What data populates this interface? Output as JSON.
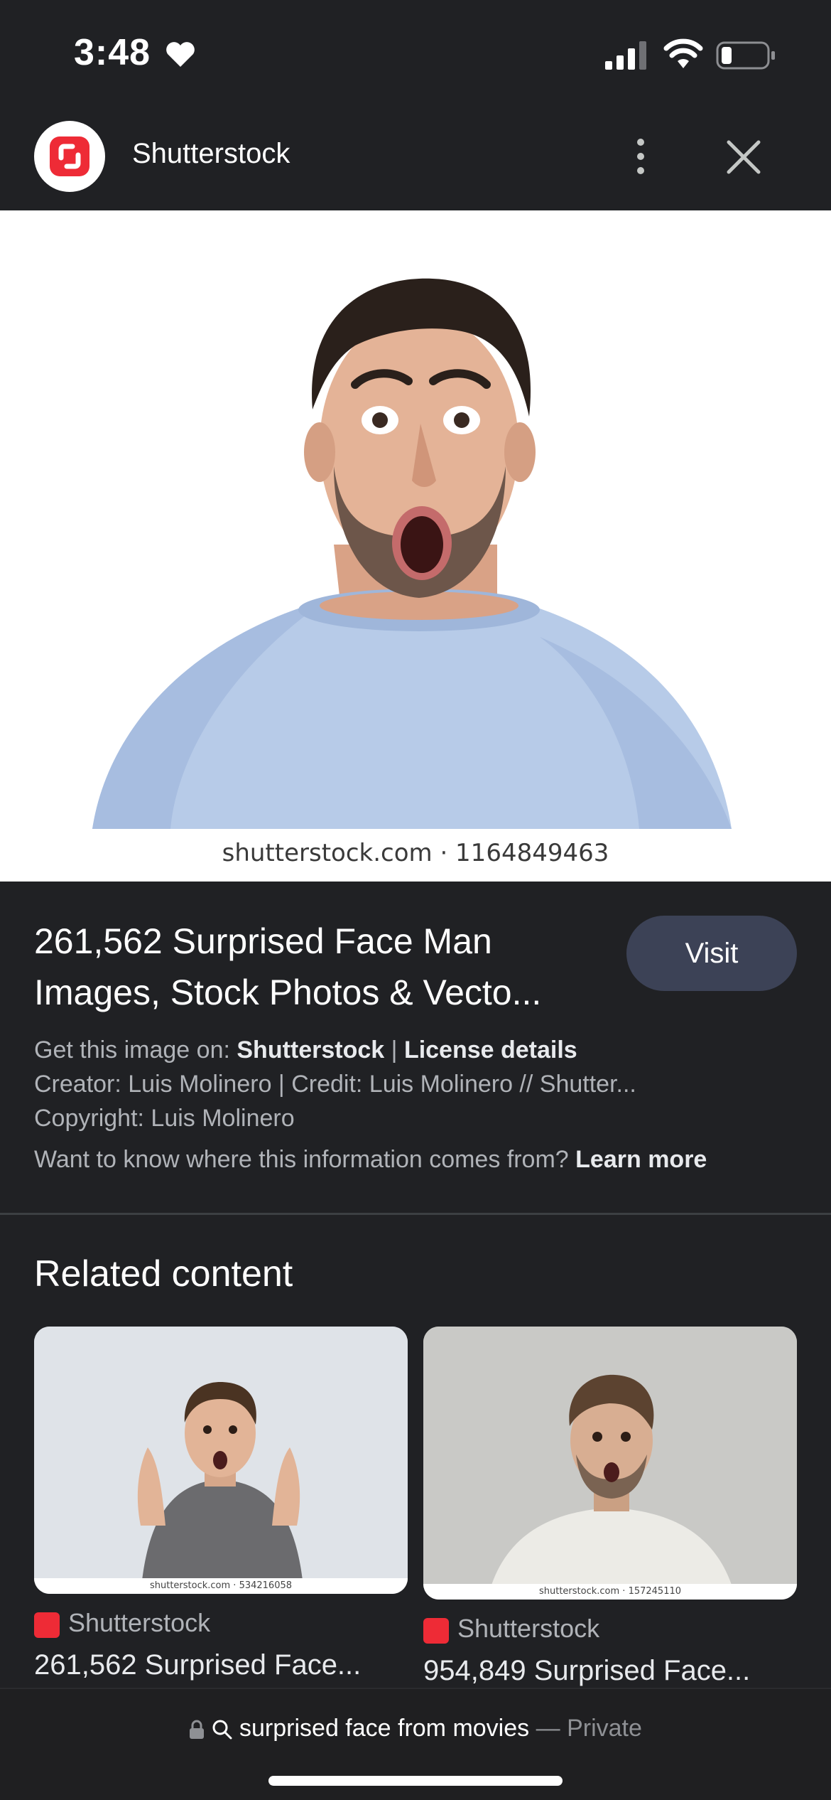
{
  "status": {
    "time": "3:48",
    "icons": [
      "heart-icon",
      "cellular-signal-icon",
      "wifi-icon",
      "battery-icon"
    ]
  },
  "header": {
    "source_name": "Shutterstock",
    "logo_icon": "shutterstock-logo",
    "more_icon": "more-vertical-icon",
    "close_icon": "close-icon"
  },
  "image": {
    "watermark": "shutterstock.com · 1164849463",
    "lens_icon": "lens-icon"
  },
  "info": {
    "title": "261,562 Surprised Face Man Images, Stock Photos & Vecto...",
    "visit_label": "Visit",
    "get_image_prefix": "Get this image on: ",
    "get_image_source": "Shutterstock",
    "separator": " | ",
    "license_label": "License details",
    "creator_line": "Creator: Luis Molinero | Credit: Luis Molinero // Shutter...",
    "copyright_line": "Copyright: Luis Molinero",
    "info_question": "Want to know where this information comes from? ",
    "learn_more": "Learn more"
  },
  "related": {
    "heading": "Related content",
    "items": [
      {
        "source": "Shutterstock",
        "title": "261,562 Surprised Face...",
        "watermark": "shutterstock.com · 534216058"
      },
      {
        "source": "Shutterstock",
        "title": "954,849 Surprised Face...",
        "watermark": "shutterstock.com · 157245110"
      }
    ]
  },
  "bottom": {
    "query": "surprised face from movies",
    "dash": " — ",
    "private_label": "Private"
  },
  "colors": {
    "background": "#202124",
    "visit_button": "#3c4256",
    "brand_red": "#ee2b36"
  }
}
